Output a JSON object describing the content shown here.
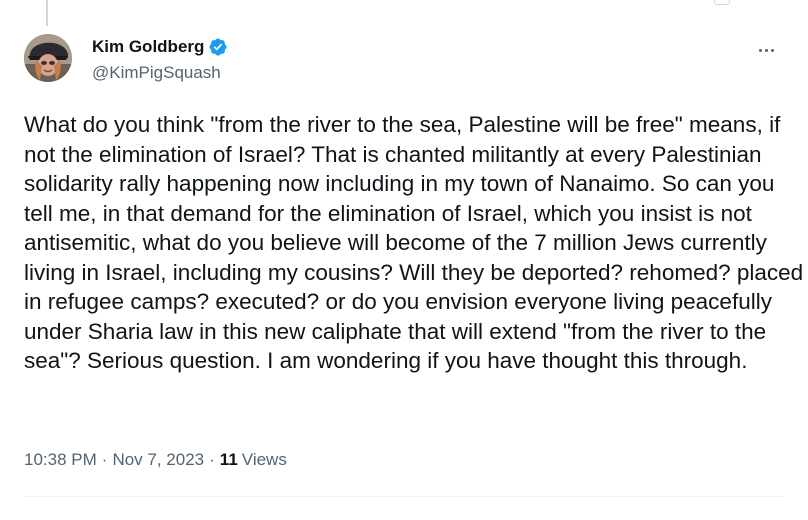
{
  "tweet": {
    "author": {
      "display_name": "Kim Goldberg",
      "handle": "@KimPigSquash",
      "verified": true,
      "verified_color": "#1d9bf0"
    },
    "text": "What do you think \"from the river to the sea, Palestine will be free\" means, if not the elimination of Israel? That is chanted militantly at every Palestinian solidarity rally happening now including in my town of Nanaimo. So can you tell me, in that demand for the elimination of Israel, which you insist is not antisemitic, what do you believe will become of the 7 million Jews currently living in Israel, including my cousins? Will they be deported? rehomed? placed in refugee camps? executed? or do you envision everyone living peacefully under Sharia law in this new caliphate that will extend \"from the river to the sea\"? Serious question. I am wondering if you have thought this through.",
    "meta": {
      "time": "10:38 PM",
      "separator": "·",
      "date": "Nov 7, 2023",
      "views_count": "11",
      "views_label": "Views"
    }
  },
  "icons": {
    "more": "more-horizontal-icon",
    "verified": "verified-badge-icon"
  },
  "colors": {
    "text_primary": "#0f1419",
    "text_secondary": "#536471",
    "thread_line": "#cfd9de"
  }
}
